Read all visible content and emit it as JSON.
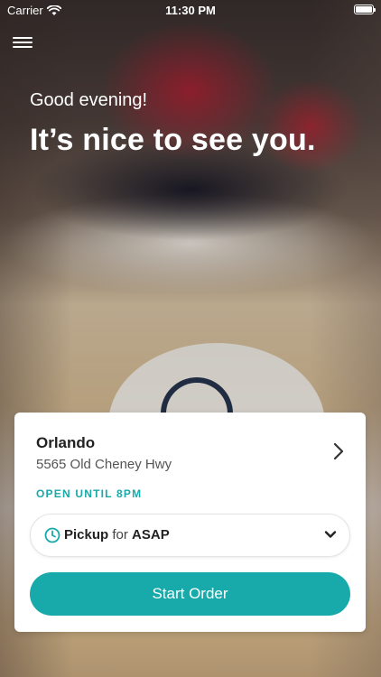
{
  "status_bar": {
    "carrier": "Carrier",
    "time": "11:30 PM"
  },
  "hero": {
    "greeting": "Good evening!",
    "headline": "It’s nice to see you."
  },
  "location": {
    "city": "Orlando",
    "address": "5565 Old Cheney Hwy",
    "hours": "OPEN UNTIL 8PM"
  },
  "order_mode": {
    "mode_label": "Pickup",
    "for_label": "for",
    "time_label": "ASAP"
  },
  "actions": {
    "start_order_label": "Start Order"
  },
  "colors": {
    "accent": "#18aaaa",
    "hours_text": "#1aa8a9"
  },
  "icons": {
    "menu": "hamburger-menu-icon",
    "wifi": "wifi-icon",
    "battery": "battery-icon",
    "chevron": "chevron-right-icon",
    "clock": "clock-icon",
    "dropdown": "chevron-down-icon"
  }
}
